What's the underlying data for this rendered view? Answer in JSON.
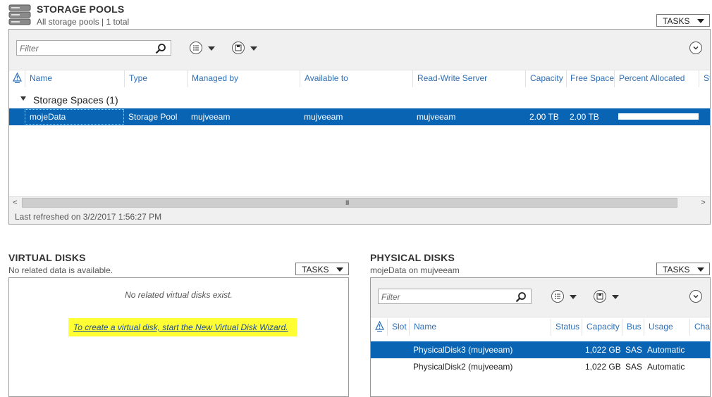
{
  "storage_pools": {
    "title": "STORAGE POOLS",
    "subtitle": "All storage pools | 1 total",
    "tasks_label": "TASKS",
    "filter_placeholder": "Filter",
    "columns": [
      "Name",
      "Type",
      "Managed by",
      "Available to",
      "Read-Write Server",
      "Capacity",
      "Free Space",
      "Percent Allocated",
      "St"
    ],
    "group_label": "Storage Spaces (1)",
    "rows": [
      {
        "name": "mojeData",
        "type": "Storage Pool",
        "managed_by": "mujveeam",
        "available_to": "mujveeam",
        "rw_server": "mujveeam",
        "capacity": "2.00 TB",
        "free_space": "2.00 TB",
        "percent_allocated": 0.02
      }
    ],
    "scroll_left": "<",
    "scroll_right": ">",
    "scroll_grip": "III",
    "footer": "Last refreshed on 3/2/2017 1:56:27 PM"
  },
  "virtual_disks": {
    "title": "VIRTUAL DISKS",
    "subtitle": "No related data is available.",
    "tasks_label": "TASKS",
    "empty_message": "No related virtual disks exist.",
    "wizard_link": "To create a virtual disk, start the New Virtual Disk Wizard."
  },
  "physical_disks": {
    "title": "PHYSICAL DISKS",
    "subtitle": "mojeData on mujveeam",
    "tasks_label": "TASKS",
    "filter_placeholder": "Filter",
    "columns": [
      "Slot",
      "Name",
      "Status",
      "Capacity",
      "Bus",
      "Usage",
      "Chas"
    ],
    "rows": [
      {
        "name": "PhysicalDisk3 (mujveeam)",
        "capacity": "1,022 GB",
        "bus": "SAS",
        "usage": "Automatic",
        "selected": true
      },
      {
        "name": "PhysicalDisk2 (mujveeam)",
        "capacity": "1,022 GB",
        "bus": "SAS",
        "usage": "Automatic",
        "selected": false
      }
    ]
  },
  "colors": {
    "selection": "#0a64b4",
    "header_text": "#2d6eb5",
    "highlight": "#ffff33"
  }
}
